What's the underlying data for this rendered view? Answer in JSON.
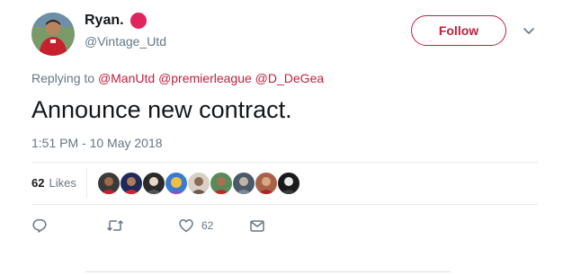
{
  "user": {
    "display_name": "Ryan.",
    "handle": "@Vintage_Utd",
    "avatar": "avatar-photo",
    "name_emoji": "red-circle"
  },
  "follow": {
    "label": "Follow"
  },
  "header_menu": {
    "icon": "chevron-down-icon"
  },
  "reply_context": {
    "prefix": "Replying to",
    "mentions": [
      "@ManUtd",
      "@premierleague",
      "@D_DeGea"
    ]
  },
  "tweet": {
    "text": "Announce new contract.",
    "timestamp": "1:51 PM - 10 May 2018"
  },
  "stats": {
    "likes_count": "62",
    "likes_label": "Likes",
    "liker_avatars": [
      "liker-avatar-1",
      "liker-avatar-2",
      "liker-avatar-3",
      "liker-avatar-4",
      "liker-avatar-5",
      "liker-avatar-6",
      "liker-avatar-7",
      "liker-avatar-8",
      "liker-avatar-9"
    ]
  },
  "actions": {
    "reply": {
      "icon": "reply-icon"
    },
    "retweet": {
      "icon": "retweet-icon"
    },
    "like": {
      "icon": "heart-icon",
      "count": "62"
    },
    "message": {
      "icon": "message-icon"
    }
  },
  "colors": {
    "accent": "#c0203c",
    "muted": "#657786",
    "text": "#14171a",
    "divider": "#e6ecf0",
    "emoji_red": "#e0245e"
  }
}
